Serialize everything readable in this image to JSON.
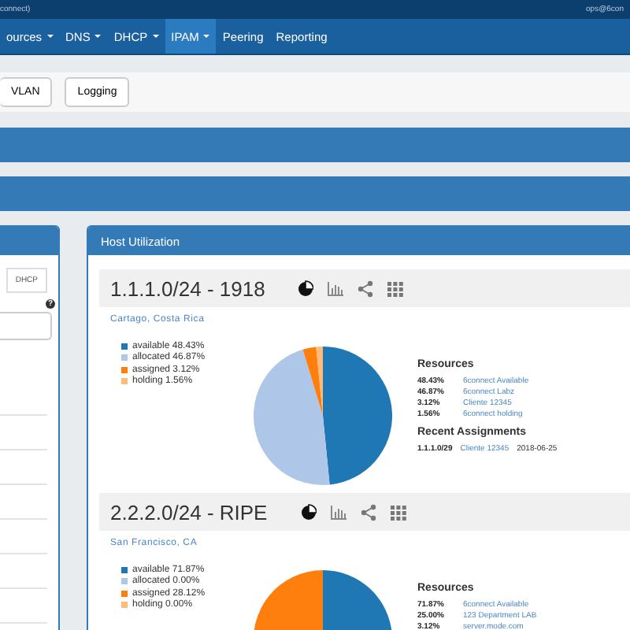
{
  "top_bar": {
    "left_text": "connect)",
    "user": "ops@6con"
  },
  "nav": [
    {
      "label": "ources",
      "caret": true,
      "selected": false
    },
    {
      "label": "DNS",
      "caret": true,
      "selected": false
    },
    {
      "label": "DHCP",
      "caret": true,
      "selected": false
    },
    {
      "label": "IPAM",
      "caret": true,
      "selected": true
    },
    {
      "label": "Peering",
      "caret": false,
      "selected": false
    },
    {
      "label": "Reporting",
      "caret": false,
      "selected": false
    }
  ],
  "toolbar": {
    "buttons": [
      "VLAN",
      "Logging"
    ]
  },
  "left_panel": {
    "tabs": [
      {
        "label": "DHCP",
        "selected": false
      }
    ],
    "help_icon": "?"
  },
  "host_utilization": {
    "title": "Host Utilization",
    "subnets": [
      {
        "heading": "1.1.1.0/24 - 1918",
        "location": "Cartago, Costa Rica",
        "legend": [
          {
            "label": "available 48.43%",
            "color": "#1f77b4"
          },
          {
            "label": "allocated 46.87%",
            "color": "#aec7e8"
          },
          {
            "label": "assigned 3.12%",
            "color": "#ff7f0e"
          },
          {
            "label": "holding 1.56%",
            "color": "#ffbb78"
          }
        ],
        "chart_data": {
          "type": "pie",
          "values": [
            48.43,
            46.87,
            3.12,
            1.56
          ]
        },
        "resources_title": "Resources",
        "resources": [
          {
            "percent": "48.43%",
            "name": "6connect Available"
          },
          {
            "percent": "46.87%",
            "name": "6connect Labz"
          },
          {
            "percent": "3.12%",
            "name": "Cliente 12345"
          },
          {
            "percent": "1.56%",
            "name": "6connect holding"
          }
        ],
        "assignments_title": "Recent Assignments",
        "assignments": [
          {
            "block": "1.1.1.0/29",
            "customer": "Cliente 12345",
            "date": "2018-06-25"
          }
        ]
      },
      {
        "heading": "2.2.2.0/24 - RIPE",
        "location": "San Francisco, CA",
        "legend": [
          {
            "label": "available 71.87%",
            "color": "#1f77b4"
          },
          {
            "label": "allocated 0.00%",
            "color": "#aec7e8"
          },
          {
            "label": "assigned 28.12%",
            "color": "#ff7f0e"
          },
          {
            "label": "holding 0.00%",
            "color": "#ffbb78"
          }
        ],
        "chart_data": {
          "type": "pie",
          "values": [
            71.87,
            0,
            28.12,
            0
          ]
        },
        "resources_title": "Resources",
        "resources": [
          {
            "percent": "71.87%",
            "name": "6connect Available"
          },
          {
            "percent": "25.00%",
            "name": "123 Department LAB"
          },
          {
            "percent": "3.12%",
            "name": "server.mode.com"
          }
        ]
      }
    ]
  }
}
